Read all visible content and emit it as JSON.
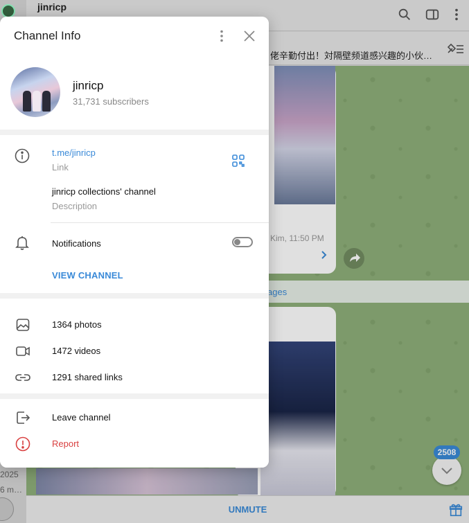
{
  "background": {
    "chat_title": "jinricp",
    "pinned_text": "佬辛勤付出！対隔壁频道感兴趣的小伙…",
    "message_meta": "Kim, 11:50 PM",
    "day_label": "ages",
    "left_years": [
      "2025",
      "6 m…",
      "2025",
      "25"
    ],
    "unread_count": "2508",
    "unmute_label": "UNMUTE"
  },
  "modal": {
    "title": "Channel Info",
    "channel_name": "jinricp",
    "subscribers": "31,731 subscribers",
    "link_value": "t.me/jinricp",
    "link_label": "Link",
    "description_value": "jinricp collections' channel",
    "description_label": "Description",
    "notifications_label": "Notifications",
    "notifications_enabled": false,
    "view_channel_label": "VIEW CHANNEL",
    "media": {
      "photos": "1364 photos",
      "videos": "1472 videos",
      "links": "1291 shared links"
    },
    "actions": {
      "leave": "Leave channel",
      "report": "Report"
    }
  },
  "colors": {
    "accent": "#3a8ad8",
    "danger": "#d94040",
    "chat_background": "#8fb07a"
  },
  "icons": [
    "info-icon",
    "qr-icon",
    "bell-icon",
    "photo-icon",
    "video-icon",
    "link-icon",
    "leave-icon",
    "report-icon",
    "more-vertical-icon",
    "close-icon",
    "search-icon",
    "sidebar-icon",
    "gift-icon",
    "chevron-down-icon",
    "forward-icon",
    "pin-list-icon"
  ]
}
